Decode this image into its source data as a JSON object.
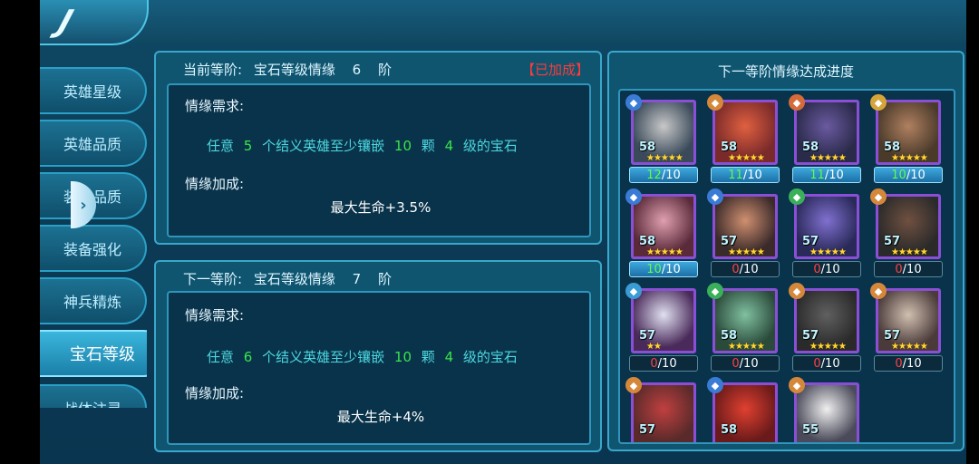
{
  "logo": {
    "glyph": "J"
  },
  "sidebar": {
    "items": [
      {
        "label": "英雄星级",
        "active": false
      },
      {
        "label": "英雄品质",
        "active": false
      },
      {
        "label": "装备品质",
        "active": false
      },
      {
        "label": "装备强化",
        "active": false
      },
      {
        "label": "神兵精炼",
        "active": false
      },
      {
        "label": "宝石等级",
        "active": true
      },
      {
        "label": "战体注灵",
        "active": false
      }
    ],
    "toggle_glyph": "›"
  },
  "current": {
    "title_prefix": "当前等阶:",
    "title_name": "宝石等级情缘",
    "title_level": "6",
    "title_suffix": "阶",
    "status": "【已加成】",
    "req_label": "情缘需求:",
    "req": {
      "w1": "任意",
      "n1": "5",
      "w2": "个结义英雄至少镶嵌",
      "n2": "10",
      "w3": "颗",
      "n3": "4",
      "w4": "级的宝石"
    },
    "bonus_label": "情缘加成:",
    "bonus": "最大生命+3.5%"
  },
  "next": {
    "title_prefix": "下一等阶:",
    "title_name": "宝石等级情缘",
    "title_level": "7",
    "title_suffix": "阶",
    "req_label": "情缘需求:",
    "req": {
      "w1": "任意",
      "n1": "6",
      "w2": "个结义英雄至少镶嵌",
      "n2": "10",
      "w3": "颗",
      "n3": "4",
      "w4": "级的宝石"
    },
    "bonus_label": "情缘加成:",
    "bonus": "最大生命+4%"
  },
  "progress": {
    "title": "下一等阶情缘达成进度",
    "heroes": [
      {
        "level": "58",
        "stars": "★★★★★",
        "count": "12",
        "total": "/10",
        "full": true
      },
      {
        "level": "58",
        "stars": "★★★★★",
        "count": "11",
        "total": "/10",
        "full": true
      },
      {
        "level": "58",
        "stars": "★★★★★",
        "count": "11",
        "total": "/10",
        "full": true
      },
      {
        "level": "58",
        "stars": "★★★★★",
        "count": "10",
        "total": "/10",
        "full": true
      },
      {
        "level": "58",
        "stars": "★★★★★",
        "count": "10",
        "total": "/10",
        "full": true
      },
      {
        "level": "57",
        "stars": "★★★★★",
        "count": "0",
        "total": "/10",
        "full": false
      },
      {
        "level": "57",
        "stars": "★★★★★",
        "count": "0",
        "total": "/10",
        "full": false
      },
      {
        "level": "57",
        "stars": "★★★★★",
        "count": "0",
        "total": "/10",
        "full": false
      },
      {
        "level": "57",
        "stars": "★★",
        "count": "0",
        "total": "/10",
        "full": false
      },
      {
        "level": "58",
        "stars": "★★★★★",
        "count": "0",
        "total": "/10",
        "full": false
      },
      {
        "level": "57",
        "stars": "★★★★★",
        "count": "0",
        "total": "/10",
        "full": false
      },
      {
        "level": "57",
        "stars": "★★★★★",
        "count": "0",
        "total": "/10",
        "full": false
      },
      {
        "level": "57",
        "stars": "",
        "count": "",
        "total": "",
        "full": false
      },
      {
        "level": "58",
        "stars": "",
        "count": "",
        "total": "",
        "full": false
      },
      {
        "level": "55",
        "stars": "",
        "count": "",
        "total": "",
        "full": false
      }
    ]
  }
}
